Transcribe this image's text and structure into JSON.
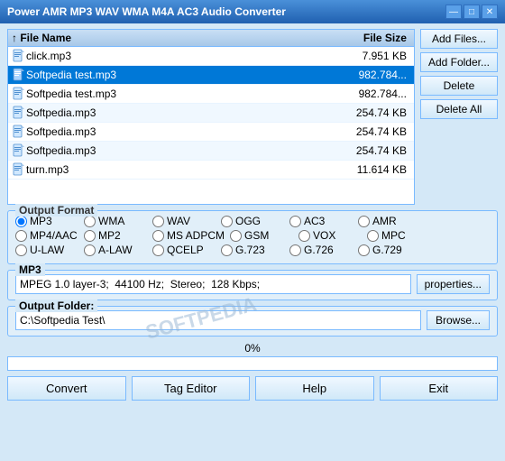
{
  "window": {
    "title": "Power AMR MP3 WAV WMA M4A AC3 Audio Converter",
    "controls": [
      "—",
      "□",
      "✕"
    ]
  },
  "file_list": {
    "headers": {
      "sort_icon": "↑",
      "name": "File Name",
      "size": "File Size"
    },
    "files": [
      {
        "name": "click.mp3",
        "size": "7.951 KB",
        "selected": false
      },
      {
        "name": "Softpedia test.mp3",
        "size": "982.784...",
        "selected": true
      },
      {
        "name": "Softpedia test.mp3",
        "size": "982.784...",
        "selected": false
      },
      {
        "name": "Softpedia.mp3",
        "size": "254.74 KB",
        "selected": false
      },
      {
        "name": "Softpedia.mp3",
        "size": "254.74 KB",
        "selected": false
      },
      {
        "name": "Softpedia.mp3",
        "size": "254.74 KB",
        "selected": false
      },
      {
        "name": "turn.mp3",
        "size": "11.614 KB",
        "selected": false
      }
    ]
  },
  "buttons": {
    "add_files": "Add Files...",
    "add_folder": "Add Folder...",
    "delete": "Delete",
    "delete_all": "Delete All"
  },
  "output_format": {
    "label": "Output Format",
    "options": [
      [
        {
          "id": "mp3",
          "label": "MP3",
          "checked": true
        },
        {
          "id": "wma",
          "label": "WMA",
          "checked": false
        },
        {
          "id": "wav",
          "label": "WAV",
          "checked": false
        },
        {
          "id": "ogg",
          "label": "OGG",
          "checked": false
        },
        {
          "id": "ac3",
          "label": "AC3",
          "checked": false
        },
        {
          "id": "amr",
          "label": "AMR",
          "checked": false
        }
      ],
      [
        {
          "id": "mp4aac",
          "label": "MP4/AAC",
          "checked": false
        },
        {
          "id": "mp2",
          "label": "MP2",
          "checked": false
        },
        {
          "id": "msadpcm",
          "label": "MS ADPCM",
          "checked": false
        },
        {
          "id": "gsm",
          "label": "GSM",
          "checked": false
        },
        {
          "id": "vox",
          "label": "VOX",
          "checked": false
        },
        {
          "id": "mpc",
          "label": "MPC",
          "checked": false
        }
      ],
      [
        {
          "id": "ulaw",
          "label": "U-LAW",
          "checked": false
        },
        {
          "id": "alaw",
          "label": "A-LAW",
          "checked": false
        },
        {
          "id": "qcelp",
          "label": "QCELP",
          "checked": false
        },
        {
          "id": "g723",
          "label": "G.723",
          "checked": false
        },
        {
          "id": "g726",
          "label": "G.726",
          "checked": false
        },
        {
          "id": "g729",
          "label": "G.729",
          "checked": false
        }
      ]
    ]
  },
  "mp3_section": {
    "label": "MP3",
    "value": "MPEG 1.0 layer-3;  44100 Hz;  Stereo;  128 Kbps;",
    "properties_btn": "properties..."
  },
  "output_folder": {
    "label": "Output Folder:",
    "value": "C:\\Softpedia Test\\",
    "browse_btn": "Browse..."
  },
  "progress": {
    "label": "0%",
    "percent": 0
  },
  "watermark": "SOFTPEDIA",
  "bottom_buttons": {
    "convert": "Convert",
    "tag_editor": "Tag Editor",
    "help": "Help",
    "exit": "Exit"
  }
}
